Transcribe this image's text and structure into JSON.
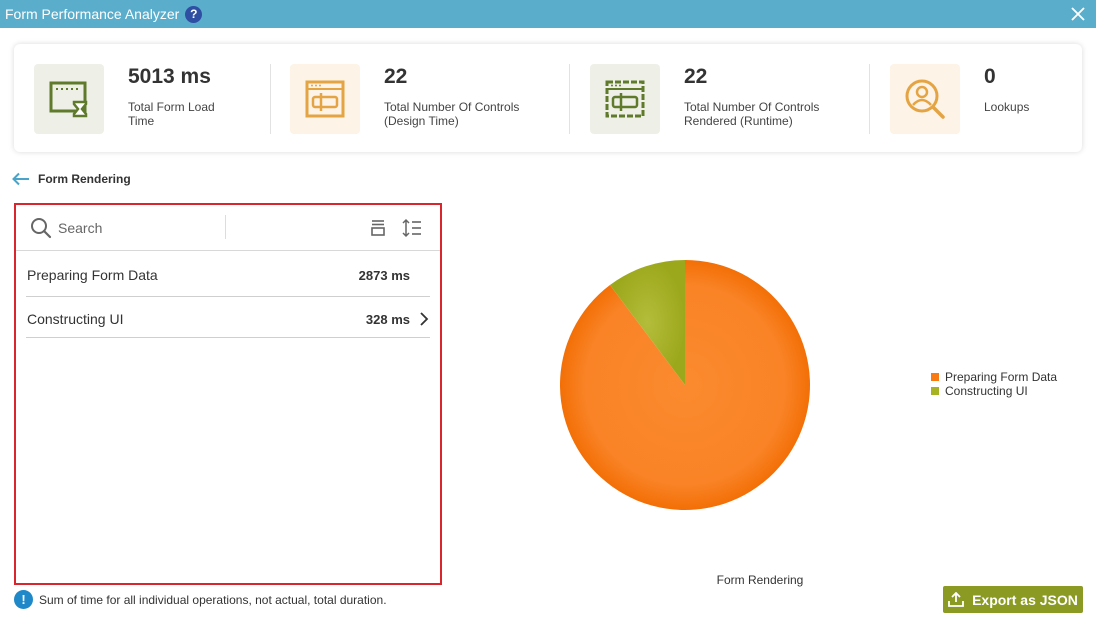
{
  "window": {
    "title": "Form Performance Analyzer",
    "help_glyph": "?"
  },
  "stats": [
    {
      "value": "5013 ms",
      "label": "Total Form Load Time",
      "icon": "form-load-time-icon",
      "bg": "#eef0e8",
      "color": "#5f7a2a"
    },
    {
      "value": "22",
      "label": "Total Number Of Controls (Design Time)",
      "icon": "controls-design-icon",
      "bg": "#fdf3e6",
      "color": "#e4a444"
    },
    {
      "value": "22",
      "label": "Total Number Of Controls Rendered (Runtime)",
      "icon": "controls-runtime-icon",
      "bg": "#eef0e8",
      "color": "#5f7a2a"
    },
    {
      "value": "0",
      "label": "Lookups",
      "icon": "lookup-user-icon",
      "bg": "#fdf3e6",
      "color": "#e4a444"
    }
  ],
  "breadcrumb": {
    "label": "Form Rendering"
  },
  "search": {
    "placeholder": "Search"
  },
  "rows": [
    {
      "label": "Preparing Form Data",
      "value": "2873 ms",
      "expandable": false
    },
    {
      "label": "Constructing UI",
      "value": "328 ms",
      "expandable": true
    }
  ],
  "note": {
    "icon_glyph": "!",
    "text": "Sum of time for all individual operations, not actual, total duration."
  },
  "export": {
    "label": "Export as JSON"
  },
  "colors": {
    "titlebar": "#5aaecb",
    "accent_orange": "#f97a12",
    "accent_olive": "#a8b324",
    "export_button": "#8a9a22",
    "panel_border": "#d9262c"
  },
  "chart_data": {
    "type": "pie",
    "title": "Form Rendering",
    "categories": [
      "Preparing Form Data",
      "Constructing UI"
    ],
    "values": [
      2873,
      328
    ],
    "colors": [
      "#f97a12",
      "#a8b324"
    ],
    "legend": "right"
  }
}
